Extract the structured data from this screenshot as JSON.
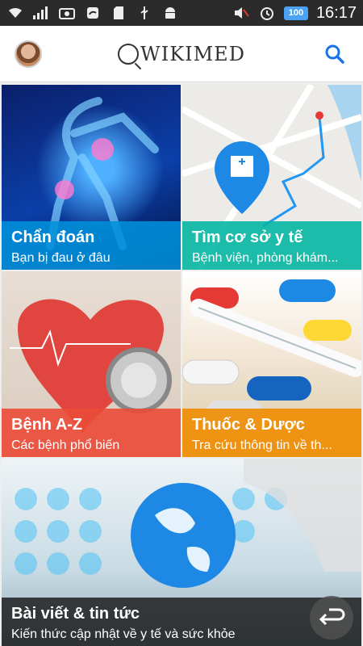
{
  "status_bar": {
    "time": "16:17",
    "battery": "100",
    "icons": [
      "wifi-icon",
      "signal-icon",
      "screenshot-icon",
      "sync-icon",
      "sd-card-icon",
      "usb-icon",
      "android-icon",
      "mute-icon",
      "alarm-icon"
    ]
  },
  "app_bar": {
    "logo_text": "WIKIMED",
    "accent_color": "#1a73e8"
  },
  "tiles": [
    {
      "title": "Chẩn đoán",
      "subtitle": "Bạn bị đau ở đâu",
      "color": "#0091dc"
    },
    {
      "title": "Tìm cơ sở y tế",
      "subtitle": "Bệnh viện, phòng khám...",
      "color": "#00b4a0"
    },
    {
      "title": "Bệnh A-Z",
      "subtitle": "Các bệnh phổ biến",
      "color": "#eb4b37"
    },
    {
      "title": "Thuốc & Dược",
      "subtitle": "Tra cứu thông tin về th...",
      "color": "#f08c00"
    },
    {
      "title": "Bài viết & tin tức",
      "subtitle": "Kiến thức cập nhật về y tế và sức khỏe",
      "color": "#191919"
    }
  ]
}
